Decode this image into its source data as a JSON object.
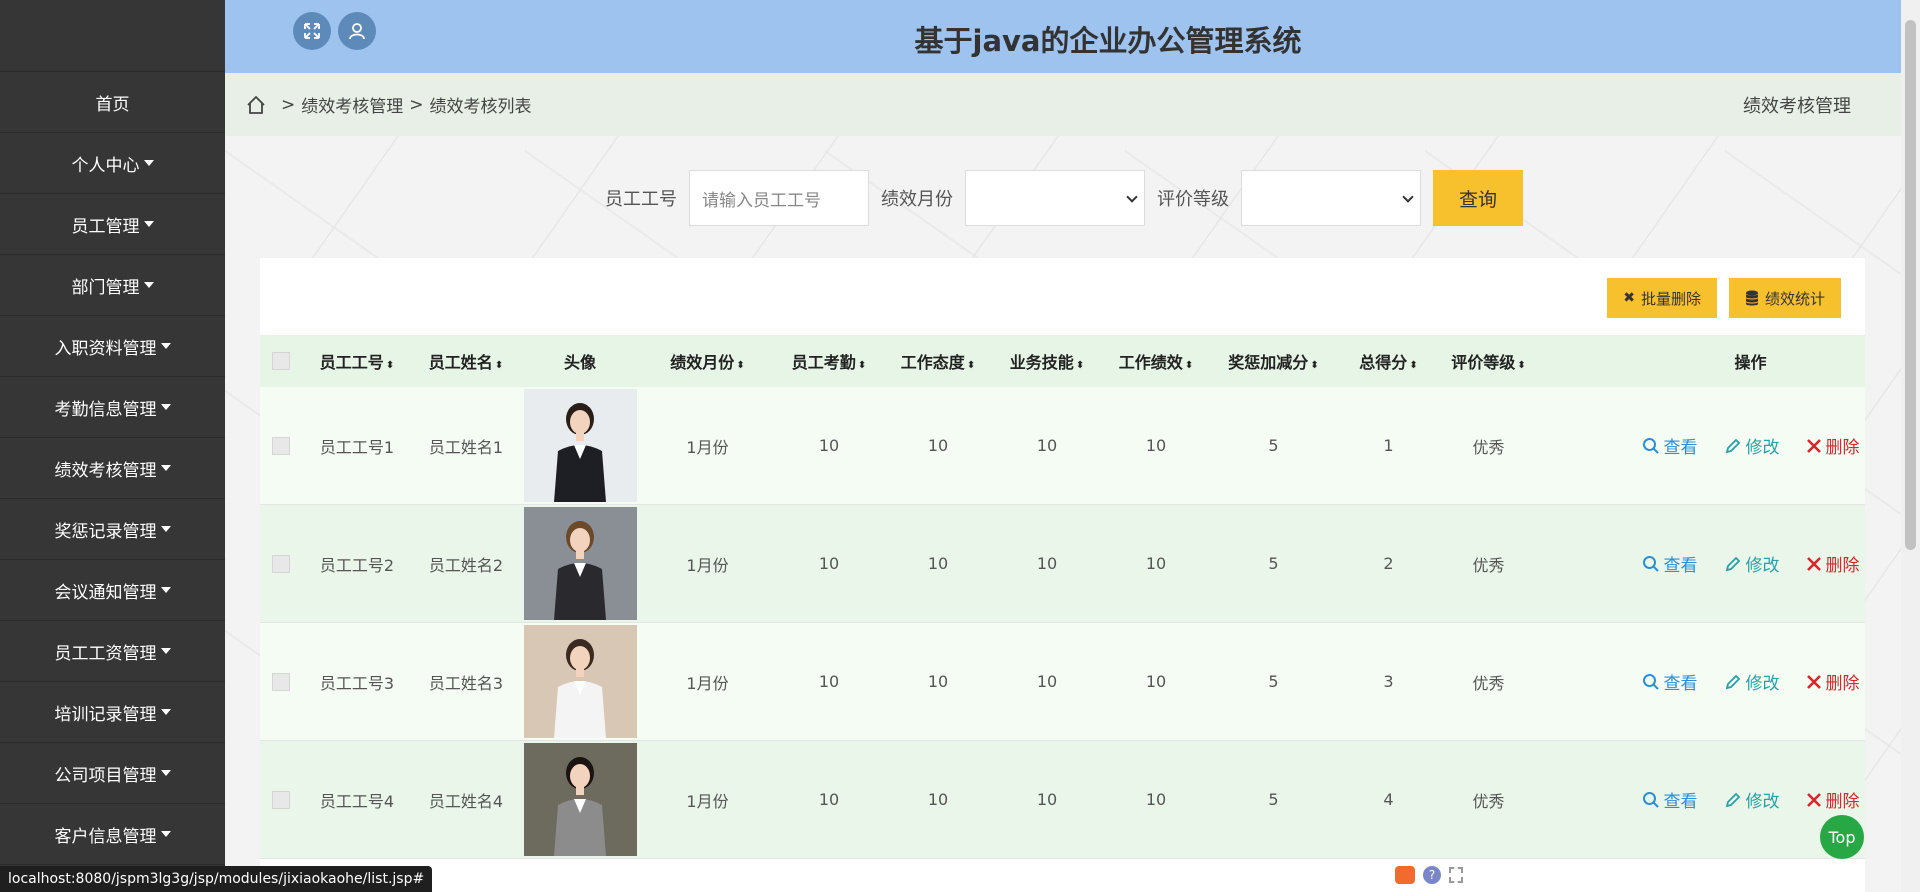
{
  "header": {
    "title": "基于java的企业办公管理系统"
  },
  "sidebar": {
    "items": [
      {
        "label": "首页",
        "has_caret": false
      },
      {
        "label": "个人中心",
        "has_caret": true
      },
      {
        "label": "员工管理",
        "has_caret": true
      },
      {
        "label": "部门管理",
        "has_caret": true
      },
      {
        "label": "入职资料管理",
        "has_caret": true
      },
      {
        "label": "考勤信息管理",
        "has_caret": true
      },
      {
        "label": "绩效考核管理",
        "has_caret": true
      },
      {
        "label": "奖惩记录管理",
        "has_caret": true
      },
      {
        "label": "会议通知管理",
        "has_caret": true
      },
      {
        "label": "员工工资管理",
        "has_caret": true
      },
      {
        "label": "培训记录管理",
        "has_caret": true
      },
      {
        "label": "公司项目管理",
        "has_caret": true
      },
      {
        "label": "客户信息管理",
        "has_caret": true
      }
    ]
  },
  "breadcrumb": {
    "sep": ">",
    "level1": "绩效考核管理",
    "level2": "绩效考核列表",
    "right_title": "绩效考核管理"
  },
  "search": {
    "emp_no_label": "员工工号",
    "emp_no_placeholder": "请输入员工工号",
    "month_label": "绩效月份",
    "month_value": "",
    "grade_label": "评价等级",
    "grade_value": "",
    "query_label": "查询"
  },
  "toolbar": {
    "batch_delete": "批量删除",
    "stats": "绩效统计"
  },
  "table": {
    "headers": [
      "员工工号",
      "员工姓名",
      "头像",
      "绩效月份",
      "员工考勤",
      "工作态度",
      "业务技能",
      "工作绩效",
      "奖惩加减分",
      "总得分",
      "评价等级",
      "操作"
    ],
    "rows": [
      {
        "emp_no": "员工工号1",
        "name": "员工姓名1",
        "month": "1月份",
        "attendance": "10",
        "attitude": "10",
        "skill": "10",
        "performance": "10",
        "bonus": "5",
        "total": "1",
        "grade": "优秀"
      },
      {
        "emp_no": "员工工号2",
        "name": "员工姓名2",
        "month": "1月份",
        "attendance": "10",
        "attitude": "10",
        "skill": "10",
        "performance": "10",
        "bonus": "5",
        "total": "2",
        "grade": "优秀"
      },
      {
        "emp_no": "员工工号3",
        "name": "员工姓名3",
        "month": "1月份",
        "attendance": "10",
        "attitude": "10",
        "skill": "10",
        "performance": "10",
        "bonus": "5",
        "total": "3",
        "grade": "优秀"
      },
      {
        "emp_no": "员工工号4",
        "name": "员工姓名4",
        "month": "1月份",
        "attendance": "10",
        "attitude": "10",
        "skill": "10",
        "performance": "10",
        "bonus": "5",
        "total": "4",
        "grade": "优秀"
      }
    ],
    "actions": {
      "view": "查看",
      "edit": "修改",
      "delete": "删除"
    }
  },
  "statusbar": {
    "url": "localhost:8080/jspm3lg3g/jsp/modules/jixiaokaohe/list.jsp#"
  },
  "top_button": "Top",
  "colors": {
    "sidebar": "#363636",
    "header": "#9ec3ef",
    "accent": "#f7c12e",
    "view": "#2a8fd8",
    "edit": "#2aa1a8",
    "delete": "#d9262c"
  }
}
